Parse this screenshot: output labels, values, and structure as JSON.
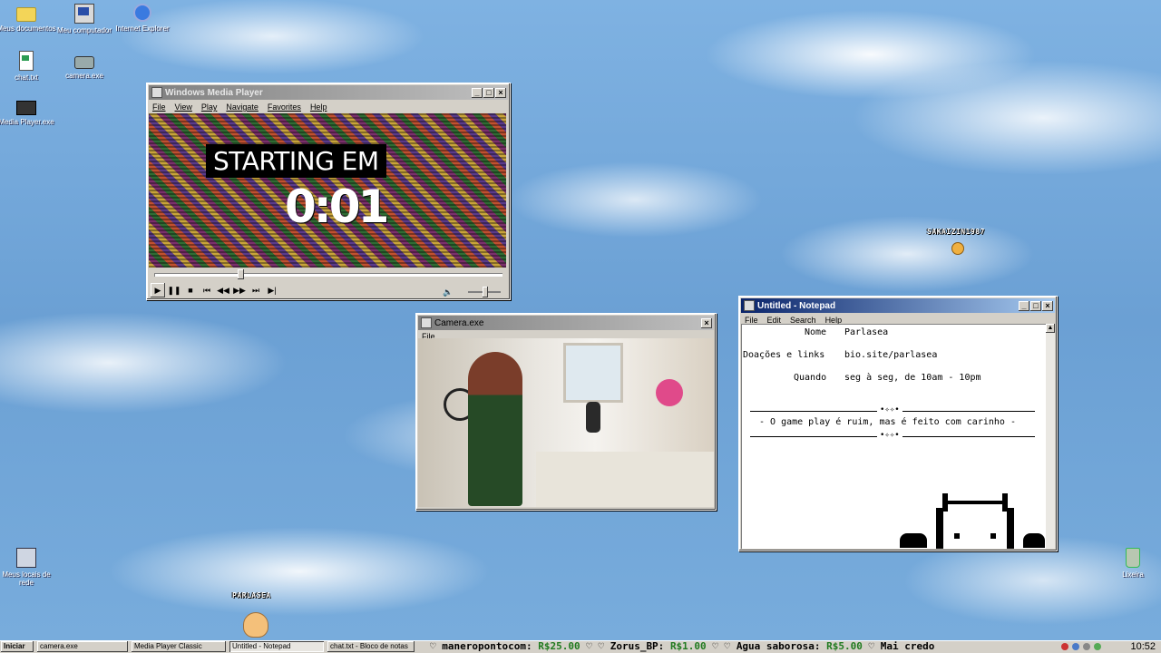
{
  "desktop": {
    "icons": [
      {
        "label": "Meus documentos",
        "icon": "folder-icon"
      },
      {
        "label": "Meu computador",
        "icon": "computer-icon"
      },
      {
        "label": "Internet Explorer",
        "icon": "internet-explorer-icon"
      },
      {
        "label": "chat.txt",
        "icon": "text-file-icon"
      },
      {
        "label": "camera.exe",
        "icon": "camera-icon"
      },
      {
        "label": "Media Player.exe",
        "icon": "media-player-icon"
      },
      {
        "label": "Meus locais de rede",
        "icon": "network-places-icon"
      },
      {
        "label": "Lixeira",
        "icon": "recycle-bin-icon"
      }
    ],
    "usernames": {
      "viewer": "SAKAIZIN1987",
      "streamer": "PARLASEA"
    }
  },
  "media_player": {
    "title": "Windows Media Player",
    "menu": [
      "File",
      "View",
      "Play",
      "Navigate",
      "Favorites",
      "Help"
    ],
    "overlay_text": "STARTING EM",
    "countdown": "0:01",
    "controls": [
      "▶",
      "❚❚",
      "■",
      "⏮",
      "◀◀",
      "▶▶",
      "⏭",
      "▶|"
    ]
  },
  "camera": {
    "title": "Camera.exe",
    "menu": [
      "File"
    ]
  },
  "notepad": {
    "title": "Untitled - Notepad",
    "menu": [
      "File",
      "Edit",
      "Search",
      "Help"
    ],
    "lines": {
      "nome_label": "Nome",
      "nome_value": "Parlasea",
      "links_label": "Doações e links",
      "links_value": "bio.site/parlasea",
      "quando_label": "Quando",
      "quando_value": "seg à seg, de 10am - 10pm",
      "ornament": "•✧✧•",
      "motto": "- O game play é ruim, mas é feito com carinho -"
    }
  },
  "taskbar": {
    "start": "Iniciar",
    "tasks": [
      "camera.exe",
      "Media Player Classic",
      "Untitled - Notepad",
      "chat.txt - Bloco de notas"
    ],
    "ticker": [
      {
        "name": "maneropontocom:",
        "amount": "R$25.00"
      },
      {
        "name": "Zorus_BP:",
        "amount": "R$1.00"
      },
      {
        "name": "Agua saborosa:",
        "amount": "R$5.00"
      },
      {
        "name": "Mai credo",
        "amount": ""
      }
    ],
    "clock": "10:52"
  },
  "colors": {
    "active_title": "#0a246a",
    "ticker_amount": "#1f7a1f",
    "win_face": "#d4d0c8"
  }
}
